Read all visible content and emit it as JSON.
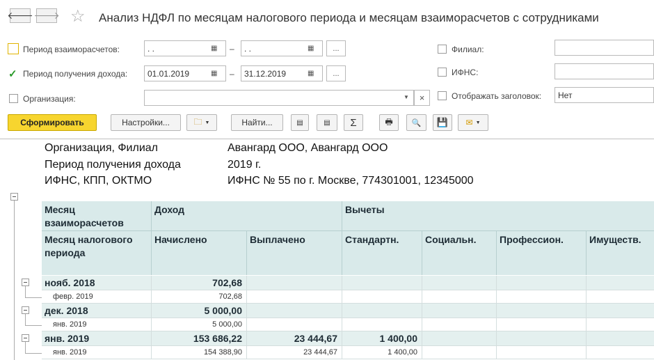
{
  "window": {
    "title": "Анализ НДФЛ по месяцам налогового периода и месяцам взаиморасчетов с сотрудниками",
    "back_icon": "arrow-left-icon",
    "forward_icon": "arrow-right-icon",
    "star_icon": "star-icon"
  },
  "filters": {
    "settlement_period": {
      "label": "Период взаиморасчетов:",
      "from": " .  . ",
      "to": " .  . ",
      "checked": false
    },
    "income_period": {
      "label": "Период получения дохода:",
      "from": "01.01.2019",
      "to": "31.12.2019",
      "checked": true
    },
    "organization": {
      "label": "Организация:",
      "value": "",
      "checked": false
    },
    "dash": "–",
    "ellipsis": "...",
    "clear_glyph": "×",
    "branch": {
      "label": "Филиал:",
      "value": ""
    },
    "ifns": {
      "label": "ИФНС:",
      "value": ""
    },
    "show_header": {
      "label": "Отображать заголовок:",
      "value": "Нет"
    }
  },
  "toolbar": {
    "generate": "Сформировать",
    "settings": "Настройки...",
    "find": "Найти...",
    "sum_glyph": "Σ"
  },
  "report": {
    "info": [
      {
        "key": "Организация, Филиал",
        "value": "Авангард ООО, Авангард ООО"
      },
      {
        "key": "Период получения дохода",
        "value": "2019 г."
      },
      {
        "key": "ИФНС, КПП, ОКТМО",
        "value": "ИФНС № 55 по г. Москве, 774301001, 12345000"
      }
    ],
    "headers": {
      "settlement_month": "Месяц взаиморасчетов",
      "tax_month": "Месяц налогового периода",
      "income": "Доход",
      "deductions": "Вычеты",
      "accrued": "Начислено",
      "paid": "Выплачено",
      "standard": "Стандартн.",
      "social": "Социальн.",
      "professional": "Профессион.",
      "property": "Имуществ."
    },
    "rows": [
      {
        "type": "group",
        "month": "нояб. 2018",
        "accrued": "702,68",
        "paid": "",
        "standard": ""
      },
      {
        "type": "sub",
        "month": "февр. 2019",
        "accrued": "702,68",
        "paid": "",
        "standard": ""
      },
      {
        "type": "group",
        "month": "дек. 2018",
        "accrued": "5 000,00",
        "paid": "",
        "standard": ""
      },
      {
        "type": "sub",
        "month": "янв. 2019",
        "accrued": "5 000,00",
        "paid": "",
        "standard": ""
      },
      {
        "type": "group",
        "month": "янв. 2019",
        "accrued": "153 686,22",
        "paid": "23 444,67",
        "standard": "1 400,00"
      },
      {
        "type": "sub",
        "month": "янв. 2019",
        "accrued": "154 388,90",
        "paid": "23 444,67",
        "standard": "1 400,00"
      }
    ]
  }
}
